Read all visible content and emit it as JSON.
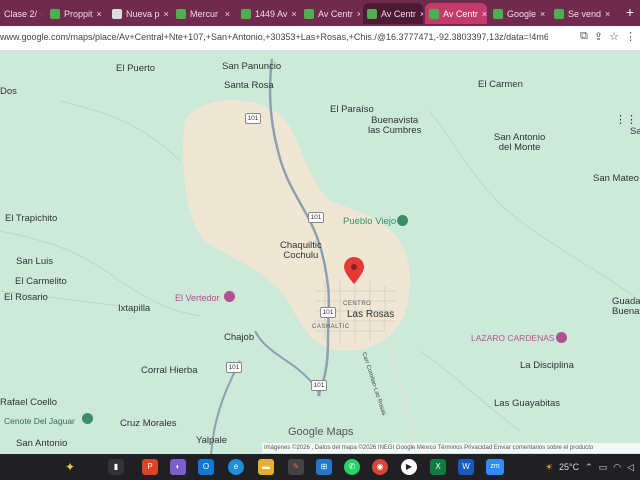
{
  "tabs": [
    {
      "label": "Clase 2/",
      "color": "#e8a33d"
    },
    {
      "label": "Proppit",
      "color": "#4caf50"
    },
    {
      "label": "Nueva p",
      "color": "#ccc"
    },
    {
      "label": "Mercur",
      "color": "#4caf50"
    },
    {
      "label": "1449 Av",
      "color": "#4caf50"
    },
    {
      "label": "Av Centr",
      "color": "#4caf50"
    },
    {
      "label": "Av Centr",
      "color": "#4caf50"
    },
    {
      "label": "Av Centr",
      "color": "#4caf50"
    },
    {
      "label": "Google",
      "color": "#4caf50"
    },
    {
      "label": "Se vend",
      "color": "#4caf50"
    }
  ],
  "address": {
    "url": "www.google.com/maps/place/Av+Central+Nte+107,+San+Antonio,+30353+Las+Rosas,+Chis./@16.3777471,-92.3803397,13z/data=!4m6!3m5!",
    "icons": [
      "tab-search-icon",
      "share-icon",
      "star-icon",
      "extensions-icon"
    ]
  },
  "map": {
    "places": [
      {
        "text": "El Puerto"
      },
      {
        "text": "San Panuncio"
      },
      {
        "text": "Santa Rosa"
      },
      {
        "text": "Dos"
      },
      {
        "text": "El Carmen"
      },
      {
        "text": "El Paraíso"
      },
      {
        "text": "Buenavista\nlas Cumbres"
      },
      {
        "text": "San Antonio\ndel Monte"
      },
      {
        "text": "San Mateo"
      },
      {
        "text": "El Trapichito"
      },
      {
        "text": "Pueblo Viejo"
      },
      {
        "text": "Chaquiltic\nCochulu"
      },
      {
        "text": "San Luis"
      },
      {
        "text": "El Carmelito"
      },
      {
        "text": "El Rosario"
      },
      {
        "text": "El Vertedor"
      },
      {
        "text": "Ixtapilla"
      },
      {
        "text": "CENTRO"
      },
      {
        "text": "Las Rosas"
      },
      {
        "text": "CASHALTIC"
      },
      {
        "text": "Chajob"
      },
      {
        "text": "LAZARO CARDENAS"
      },
      {
        "text": "Guadal\nBuenav"
      },
      {
        "text": "La Disciplina"
      },
      {
        "text": "Corral Hierba"
      },
      {
        "text": "Rafael Coello"
      },
      {
        "text": "Cenote Del Jaguar"
      },
      {
        "text": "Las Guayabitas"
      },
      {
        "text": "Cruz Morales"
      },
      {
        "text": "San Antonio"
      },
      {
        "text": "Yalpale"
      },
      {
        "text": "Carr Comitan-Las Rosas"
      },
      {
        "text": "Sa"
      }
    ],
    "route_shields": [
      "101",
      "101",
      "101",
      "101",
      "101"
    ],
    "logo": "Google Maps",
    "attribution": "Imágenes ©2026 , Datos del mapa ©2026 INEGI  Google    México    Términos    Privacidad    Enviar comentarios sobre el producto"
  },
  "taskbar": {
    "temperature": "25°C",
    "apps": [
      "copilot-icon",
      "task-view-icon",
      "powerpoint-icon",
      "copilot-app-icon",
      "outlook-icon",
      "edge-icon",
      "file-explorer-icon",
      "pen-icon",
      "windows-icon",
      "whatsapp-icon",
      "chrome-icon",
      "media-player-icon",
      "excel-icon",
      "word-icon",
      "zoom-icon"
    ],
    "zoom_label": "zm"
  }
}
